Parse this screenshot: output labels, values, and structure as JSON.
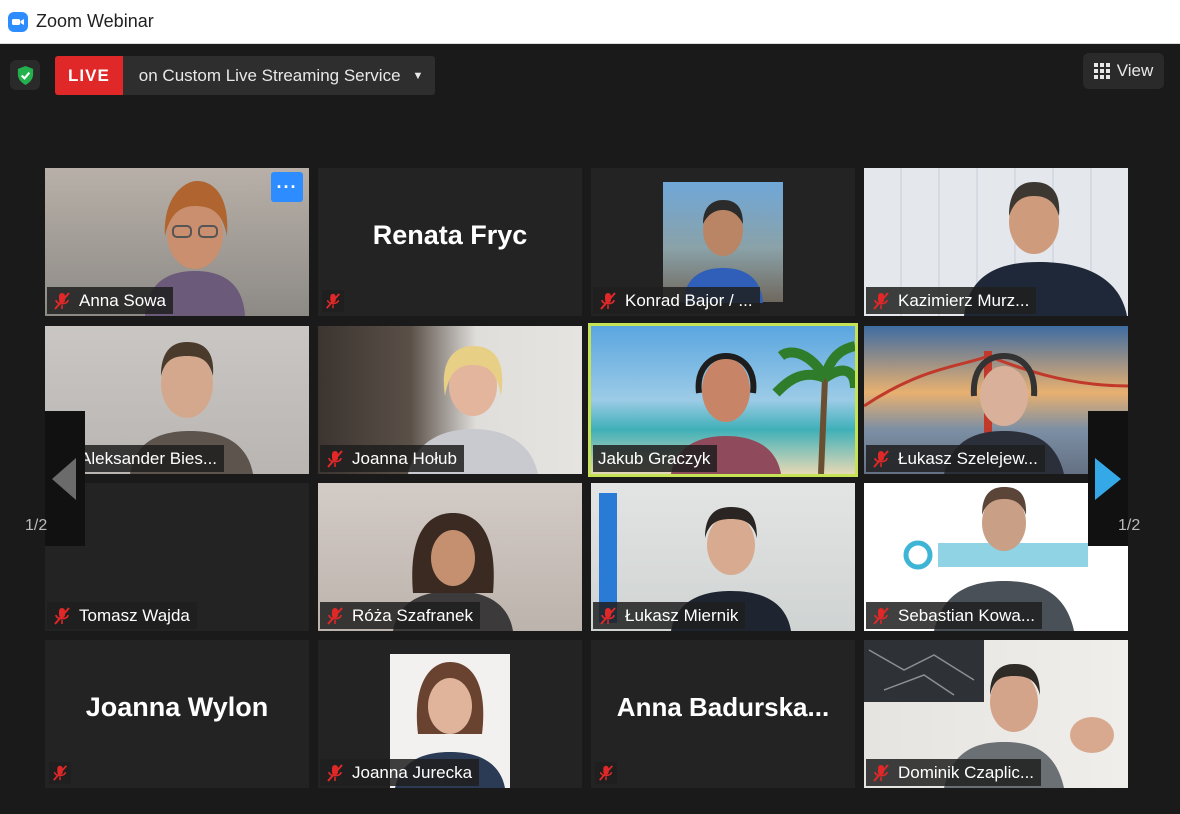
{
  "window": {
    "title": "Zoom Webinar"
  },
  "toolbar": {
    "live_label": "LIVE",
    "stream_target": "on Custom Live Streaming Service",
    "view_label": "View"
  },
  "pager": {
    "left_page": "1/2",
    "right_page": "1/2"
  },
  "tiles": [
    {
      "name": "Anna Sowa"
    },
    {
      "name": "Renata Fryc"
    },
    {
      "name": "Konrad Bajor / ..."
    },
    {
      "name": "Kazimierz Murz..."
    },
    {
      "name": "Aleksander Bies..."
    },
    {
      "name": "Joanna Hołub"
    },
    {
      "name": "Jakub Graczyk"
    },
    {
      "name": "Łukasz Szelejew..."
    },
    {
      "name": "Tomasz Wajda"
    },
    {
      "name": "Róża Szafranek"
    },
    {
      "name": "Łukasz Miernik"
    },
    {
      "name": "Sebastian Kowa..."
    },
    {
      "name": "Joanna Wylon"
    },
    {
      "name": "Joanna Jurecka"
    },
    {
      "name": "Anna  Badurska..."
    },
    {
      "name": "Dominik Czaplic..."
    }
  ],
  "colors": {
    "live": "#e02828",
    "active_speaker": "#c6e356",
    "accent": "#2d8cff",
    "mute": "#e02828"
  }
}
